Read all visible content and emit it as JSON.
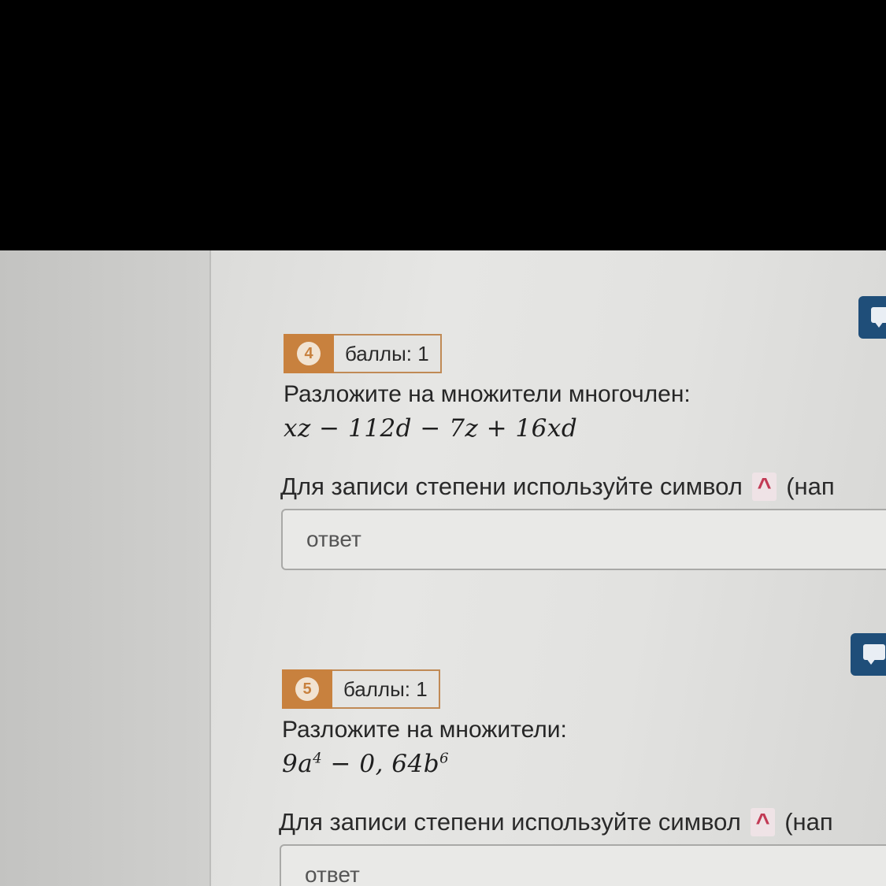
{
  "questions": [
    {
      "number": "4",
      "score": "баллы: 1",
      "prompt": "Разложите на множители многочлен:",
      "formula": "xz − 112d − 7z + 16xd",
      "hint_before": "Для записи степени используйте символ",
      "hint_symbol": "^",
      "hint_after": "(нап",
      "answer_placeholder": "ответ"
    },
    {
      "number": "5",
      "score": "баллы: 1",
      "prompt": "Разложите на множители:",
      "formula_parts": [
        "9a",
        "4",
        " − 0, 64b",
        "6"
      ],
      "hint_before": "Для записи степени используйте символ",
      "hint_symbol": "^",
      "hint_after": "(нап",
      "answer_placeholder": "ответ"
    }
  ],
  "colors": {
    "badge": "#c8813e",
    "chat_button": "#1f4e79",
    "caret": "#c23a55"
  },
  "icons": {
    "chat": "chat-bubble-icon"
  }
}
